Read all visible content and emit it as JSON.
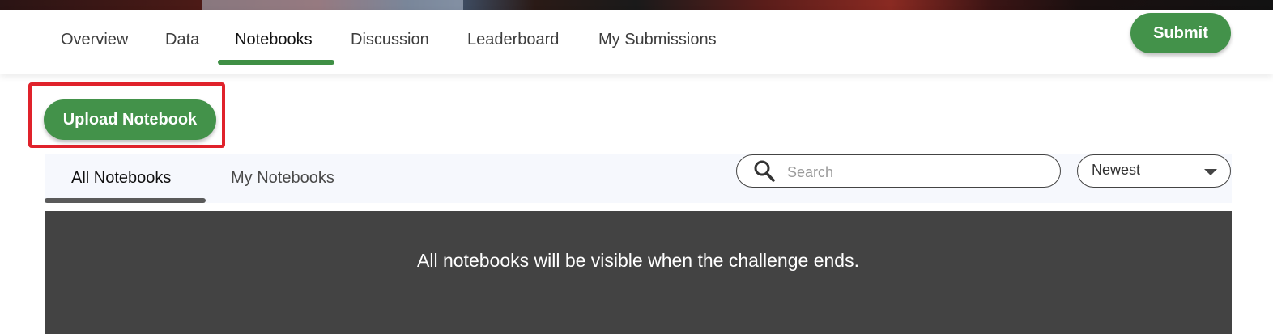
{
  "nav": {
    "tabs": [
      {
        "label": "Overview"
      },
      {
        "label": "Data"
      },
      {
        "label": "Notebooks",
        "active": true
      },
      {
        "label": "Discussion"
      },
      {
        "label": "Leaderboard"
      },
      {
        "label": "My Submissions"
      }
    ],
    "submit_label": "Submit"
  },
  "notebooks": {
    "upload_label": "Upload Notebook",
    "subtabs": [
      {
        "label": "All Notebooks",
        "active": true
      },
      {
        "label": "My Notebooks"
      }
    ],
    "search": {
      "placeholder": "Search",
      "value": ""
    },
    "sort": {
      "selected": "Newest"
    },
    "notice": "All notebooks will be visible when the challenge ends."
  },
  "colors": {
    "accent_green": "#43924a",
    "highlight_red": "#e0222b",
    "panel_dark": "#434343"
  },
  "icons": {
    "search": "search-icon",
    "sort_caret": "chevron-down-icon"
  }
}
